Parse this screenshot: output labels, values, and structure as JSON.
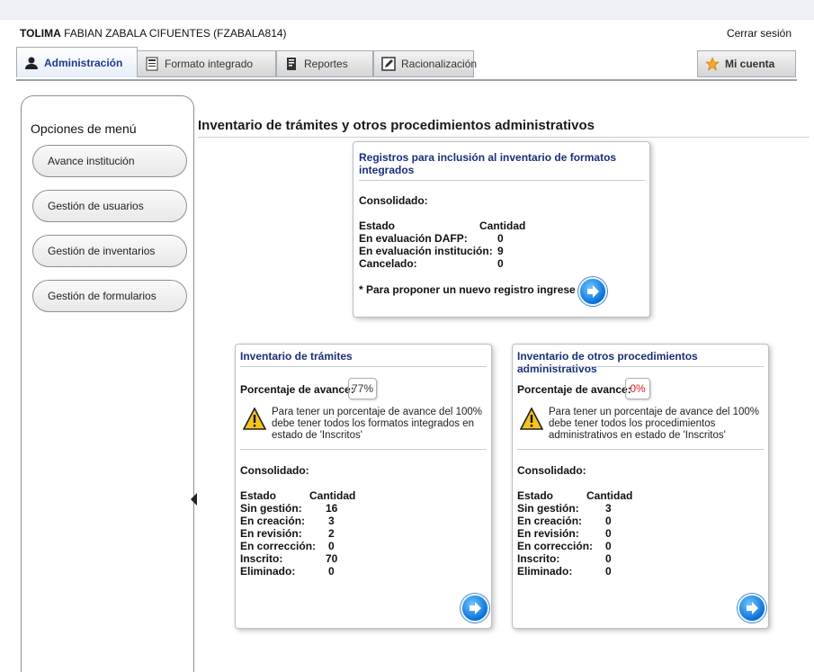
{
  "header": {
    "dept": "TOLIMA",
    "user": "FABIAN ZABALA CIFUENTES (FZABALA814)",
    "logout_label": "Cerrar sesión"
  },
  "tabs": [
    {
      "label": "Administración",
      "icon": "user-icon"
    },
    {
      "label": "Formato integrado",
      "icon": "document-icon"
    },
    {
      "label": "Reportes",
      "icon": "report-icon"
    },
    {
      "label": "Racionalización",
      "icon": "edit-icon"
    }
  ],
  "account_label": "Mi cuenta",
  "sidebar": {
    "title": "Opciones de menú",
    "items": [
      "Avance institución",
      "Gestión de usuarios",
      "Gestión de inventarios",
      "Gestión de formularios"
    ]
  },
  "page_title": "Inventario de trámites y otros procedimientos administrativos",
  "registros": {
    "title": "Registros para inclusión al inventario de formatos integrados",
    "consolidado": "Consolidado:",
    "col_estado": "Estado",
    "col_cantidad": "Cantidad",
    "rows": [
      {
        "label": "En evaluación DAFP:",
        "value": "0"
      },
      {
        "label": "En evaluación institución:",
        "value": "9"
      },
      {
        "label": "Cancelado:",
        "value": "0"
      }
    ],
    "propose_text": "* Para proponer un nuevo registro ingrese aquí"
  },
  "tramites": {
    "title": "Inventario de trámites",
    "pct_label": "Porcentaje de avance:",
    "pct_value": "77%",
    "warning": "Para tener un porcentaje de avance del 100% debe tener todos los formatos integrados en estado de 'Inscritos'",
    "consolidado": "Consolidado:",
    "col_estado": "Estado",
    "col_cantidad": "Cantidad",
    "rows": [
      {
        "label": "Sin gestión:",
        "value": "16"
      },
      {
        "label": "En creación:",
        "value": "3"
      },
      {
        "label": "En revisión:",
        "value": "2"
      },
      {
        "label": "En corrección:",
        "value": "0"
      },
      {
        "label": "Inscrito:",
        "value": "70"
      },
      {
        "label": "Eliminado:",
        "value": "0"
      }
    ]
  },
  "otros": {
    "title": "Inventario de otros procedimientos administrativos",
    "pct_label": "Porcentaje de avance:",
    "pct_value": "0%",
    "warning": "Para tener un porcentaje de avance del 100% debe tener todos los procedimientos administrativos en estado de 'Inscritos'",
    "consolidado": "Consolidado:",
    "col_estado": "Estado",
    "col_cantidad": "Cantidad",
    "rows": [
      {
        "label": "Sin gestión:",
        "value": "3"
      },
      {
        "label": "En creación:",
        "value": "0"
      },
      {
        "label": "En revisión:",
        "value": "0"
      },
      {
        "label": "En corrección:",
        "value": "0"
      },
      {
        "label": "Inscrito:",
        "value": "0"
      },
      {
        "label": "Eliminado:",
        "value": "0"
      }
    ]
  },
  "colors": {
    "title_blue": "#1a2f78",
    "pct_ok": "#333333",
    "pct_zero": "#d62020"
  }
}
